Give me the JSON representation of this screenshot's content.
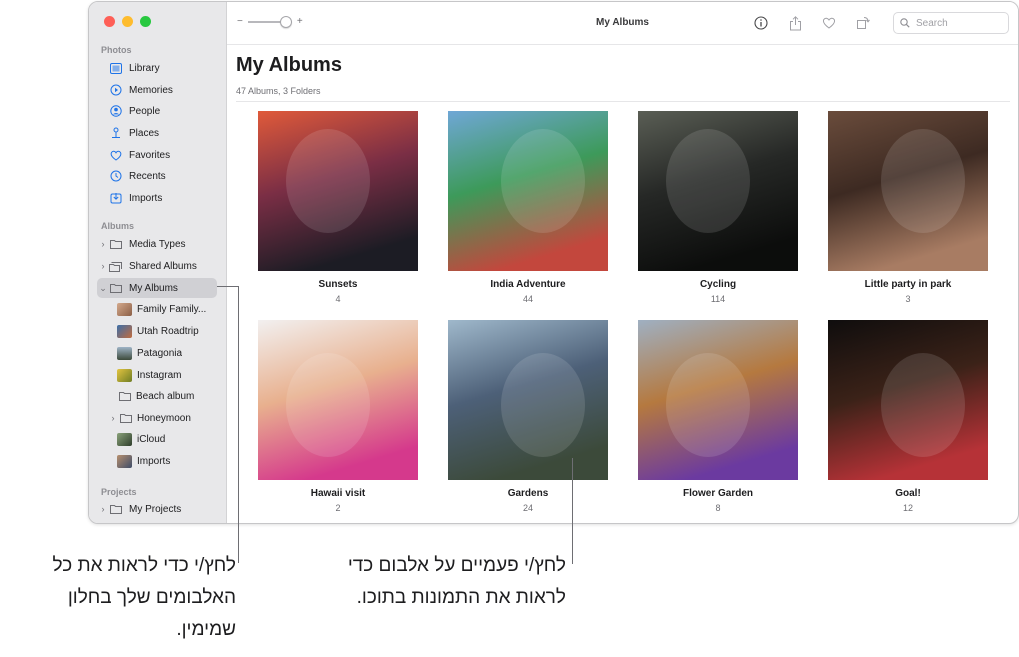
{
  "window": {
    "title": "My Albums",
    "zoom": {
      "minus": "−",
      "plus": "+",
      "level": 0.85
    }
  },
  "sidebar": {
    "sections": [
      {
        "label": "Photos",
        "items": [
          {
            "label": "Library",
            "icon": "library-icon"
          },
          {
            "label": "Memories",
            "icon": "memories-icon"
          },
          {
            "label": "People",
            "icon": "person-icon"
          },
          {
            "label": "Places",
            "icon": "pin-icon"
          },
          {
            "label": "Favorites",
            "icon": "heart-icon"
          },
          {
            "label": "Recents",
            "icon": "clock-icon"
          },
          {
            "label": "Imports",
            "icon": "import-icon"
          }
        ]
      },
      {
        "label": "Albums",
        "items": [
          {
            "label": "Media Types",
            "icon": "folder-icon",
            "expandable": true
          },
          {
            "label": "Shared Albums",
            "icon": "shared-folder-icon",
            "expandable": true
          },
          {
            "label": "My Albums",
            "icon": "folder-icon",
            "expandable": true,
            "expanded": true,
            "selected": true
          }
        ]
      },
      {
        "label": "Projects",
        "items": [
          {
            "label": "My Projects",
            "icon": "folder-icon",
            "expandable": true
          }
        ]
      }
    ],
    "my_albums_children": [
      {
        "label": "Family Family...",
        "thumb": "#b9876a"
      },
      {
        "label": "Utah Roadtrip",
        "thumb": "#c06b3e"
      },
      {
        "label": "Patagonia",
        "thumb": "#5d6f82"
      },
      {
        "label": "Instagram",
        "thumb": "#c9a72c"
      },
      {
        "label": "Beach album",
        "thumb": "folder"
      },
      {
        "label": "Honeymoon",
        "thumb": "folder",
        "expandable": true
      },
      {
        "label": "iCloud",
        "thumb": "#4f6b4a"
      },
      {
        "label": "Imports",
        "thumb": "#5f6e8a"
      }
    ]
  },
  "toolbar": {
    "search_placeholder": "Search",
    "icons": [
      "info-icon",
      "share-icon",
      "heart-icon",
      "rotate-icon"
    ]
  },
  "main": {
    "title": "My Albums",
    "subtitle": "47 Albums, 3 Folders",
    "albums": [
      {
        "name": "Sunsets",
        "count": "4",
        "colors": [
          "#e05a3a",
          "#7a2e45",
          "#1c1c24"
        ]
      },
      {
        "name": "India Adventure",
        "count": "44",
        "colors": [
          "#6fa7d6",
          "#3d9a5a",
          "#c3473d"
        ]
      },
      {
        "name": "Cycling",
        "count": "114",
        "colors": [
          "#5a5e55",
          "#262826",
          "#0c0d0c"
        ]
      },
      {
        "name": "Little party in park",
        "count": "3",
        "colors": [
          "#6a4c3c",
          "#3d2a22",
          "#a87c63"
        ]
      },
      {
        "name": "Hawaii visit",
        "count": "2",
        "colors": [
          "#f2f0f0",
          "#e8b08e",
          "#d5398c"
        ]
      },
      {
        "name": "Gardens",
        "count": "24",
        "colors": [
          "#9fb8cb",
          "#4d6078",
          "#3c4a3a"
        ]
      },
      {
        "name": "Flower Garden",
        "count": "8",
        "colors": [
          "#9fb0c2",
          "#b5793f",
          "#6b3aa0"
        ]
      },
      {
        "name": "Goal!",
        "count": "12",
        "colors": [
          "#0f0d0d",
          "#3b2218",
          "#b63237"
        ]
      }
    ]
  },
  "annotations": [
    {
      "text": "לחץ/י כדי לראות את כל האלבומים שלך בחלון שמימין."
    },
    {
      "text": "לחץ/י פעמיים על אלבום כדי לראות את התמונות בתוכו."
    }
  ]
}
